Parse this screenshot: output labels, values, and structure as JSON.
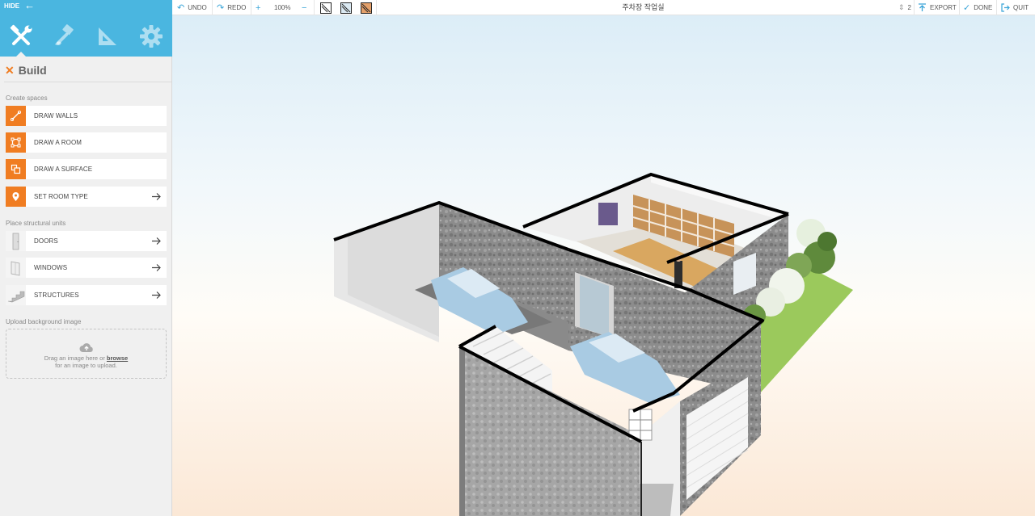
{
  "sidebar": {
    "hide_label": "HIDE",
    "modes": [
      "build-mode",
      "decorate-mode",
      "measure-mode",
      "settings-mode"
    ],
    "build_title": "Build",
    "sections": {
      "create": "Create spaces",
      "structural": "Place structural units",
      "upload": "Upload background image"
    },
    "create_items": [
      {
        "label": "DRAW WALLS",
        "icon": "draw-walls-icon"
      },
      {
        "label": "DRAW A ROOM",
        "icon": "draw-room-icon"
      },
      {
        "label": "DRAW A SURFACE",
        "icon": "draw-surface-icon"
      },
      {
        "label": "SET ROOM TYPE",
        "icon": "location-pin-icon"
      }
    ],
    "structural_items": [
      {
        "label": "DOORS",
        "icon": "door-icon"
      },
      {
        "label": "WINDOWS",
        "icon": "window-icon"
      },
      {
        "label": "STRUCTURES",
        "icon": "stairs-icon"
      }
    ],
    "upload": {
      "line1_prefix": "Drag an image here or ",
      "browse": "browse",
      "line2": "for an image to upload."
    }
  },
  "toolbar": {
    "undo": "UNDO",
    "redo": "REDO",
    "zoom": "100%",
    "title": "주차장 작업실",
    "level": "2",
    "export": "EXPORT",
    "done": "DONE",
    "quit": "QUIT"
  },
  "colors": {
    "sidebar_header": "#4ab6e0",
    "accent_orange": "#f07d22",
    "toolbar_blue": "#3aa5d8"
  }
}
